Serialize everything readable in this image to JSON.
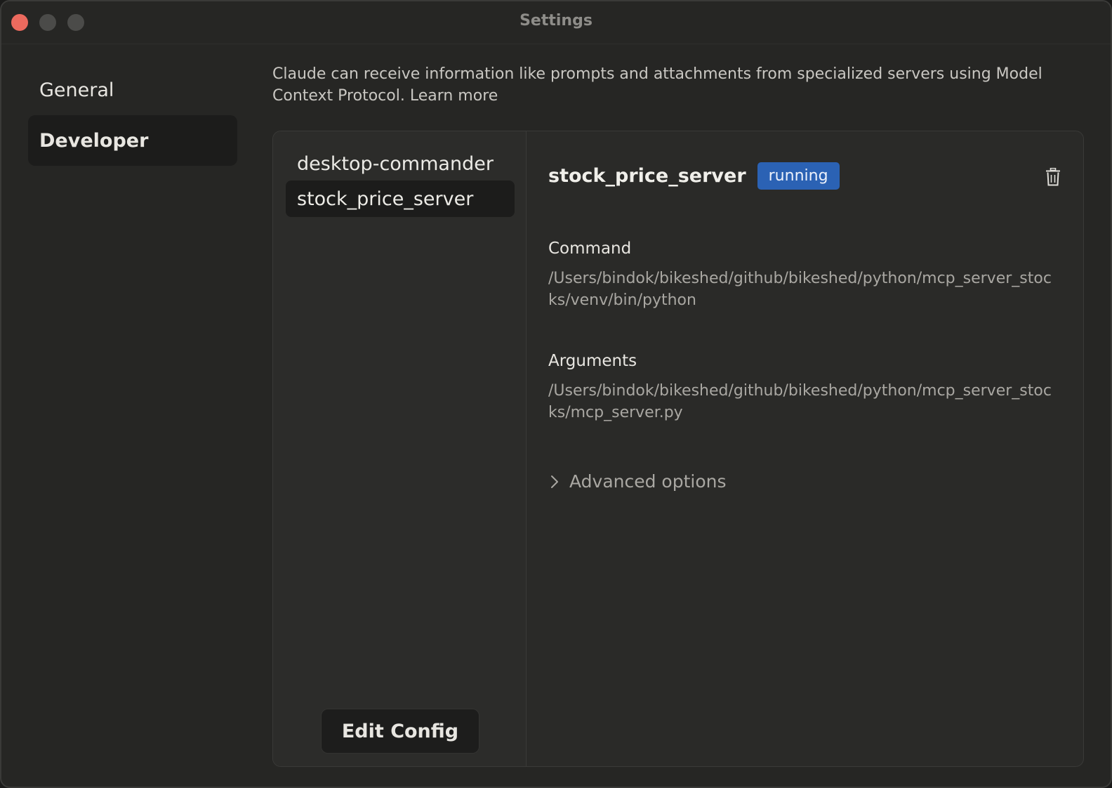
{
  "window": {
    "title": "Settings"
  },
  "sidebar": {
    "items": [
      {
        "label": "General",
        "active": false
      },
      {
        "label": "Developer",
        "active": true
      }
    ]
  },
  "main": {
    "description": "Claude can receive information like prompts and attachments from specialized servers using Model Context Protocol.",
    "learn_more": "Learn more"
  },
  "servers": {
    "list": [
      {
        "name": "desktop-commander",
        "selected": false
      },
      {
        "name": "stock_price_server",
        "selected": true
      }
    ],
    "edit_config_label": "Edit Config"
  },
  "detail": {
    "name": "stock_price_server",
    "status": "running",
    "status_color": "#2b62b4",
    "command_label": "Command",
    "command_value": "/Users/bindok/bikeshed/github/bikeshed/python/mcp_server_stocks/venv/bin/python",
    "arguments_label": "Arguments",
    "arguments_value": "/Users/bindok/bikeshed/github/bikeshed/python/mcp_server_stocks/mcp_server.py",
    "advanced_label": "Advanced options",
    "delete_icon": "trash-icon",
    "expand_icon": "chevron-right-icon"
  }
}
